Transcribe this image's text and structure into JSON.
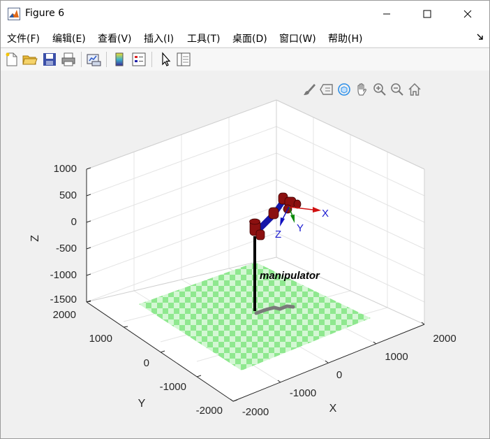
{
  "window": {
    "title": "Figure 6",
    "buttons": {
      "minimize": "—",
      "maximize": "☐",
      "close": "✕"
    }
  },
  "menu": [
    {
      "label": "文件(F)"
    },
    {
      "label": "编辑(E)"
    },
    {
      "label": "查看(V)"
    },
    {
      "label": "插入(I)"
    },
    {
      "label": "工具(T)"
    },
    {
      "label": "桌面(D)"
    },
    {
      "label": "窗口(W)"
    },
    {
      "label": "帮助(H)"
    }
  ],
  "toolbar": {
    "icons": [
      "new-figure-icon",
      "open-file-icon",
      "save-icon",
      "print-icon",
      "link-plot-icon",
      "colorbar-icon",
      "legend-icon",
      "edit-plot-icon",
      "property-inspector-icon"
    ]
  },
  "axes_toolbar": {
    "icons": [
      "brush-icon",
      "data-tips-icon",
      "rotate-3d-icon",
      "pan-icon",
      "zoom-in-icon",
      "zoom-out-icon",
      "restore-view-icon"
    ]
  },
  "plot": {
    "z_ticks": [
      "1000",
      "500",
      "0",
      "-500",
      "-1000",
      "-1500"
    ],
    "y_ticks": [
      "2000",
      "1000",
      "0",
      "-1000",
      "-2000"
    ],
    "x_ticks": [
      "-2000",
      "-1000",
      "0",
      "1000",
      "2000"
    ],
    "z_label": "Z",
    "y_label": "Y",
    "x_label": "X",
    "robot_label": "manipulator",
    "frame_labels": {
      "x": "X",
      "y": "Y",
      "z": "Z"
    },
    "colors": {
      "link": "#1515a8",
      "joint": "#8b1010",
      "floor_a": "#8fe88f",
      "floor_b": "#d4f7d4",
      "base": "#000000",
      "shadow": "#7a7a7a",
      "frame_x": "#d01010",
      "frame_y": "#0a8a0a",
      "frame_z": "#1010c0",
      "frame_text": "#1a1ad0"
    }
  }
}
